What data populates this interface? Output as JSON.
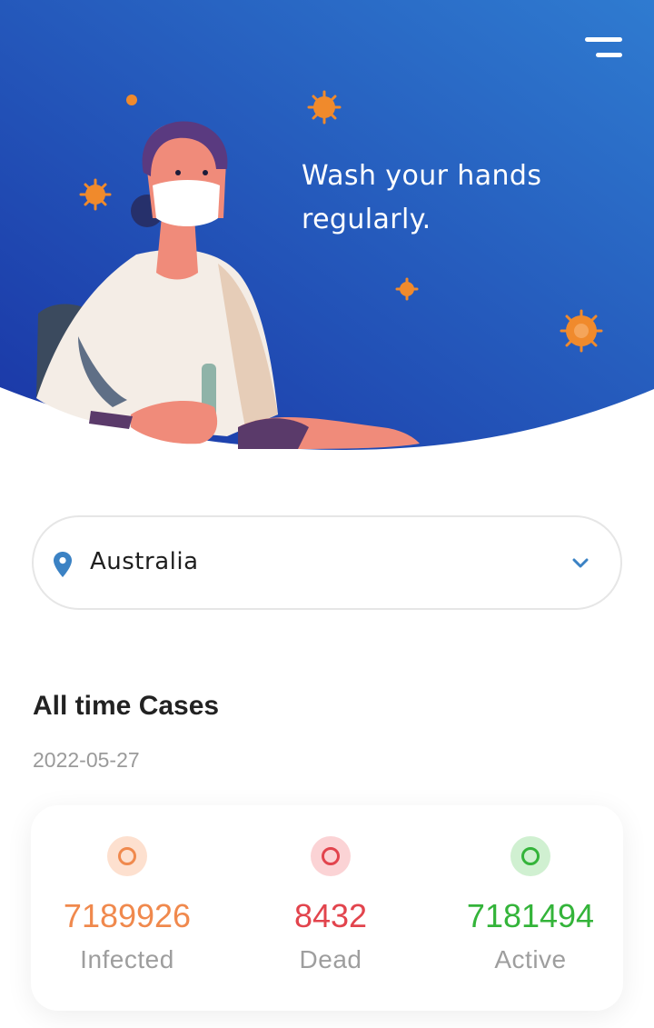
{
  "hero": {
    "message": "Wash your hands regularly.",
    "gradient": [
      "#1a36a6",
      "#2f7bd0"
    ]
  },
  "header": {
    "menu_icon": "menu-icon"
  },
  "country_select": {
    "icon": "location-pin-icon",
    "value": "Australia",
    "dropdown_icon": "chevron-down-icon",
    "accent": "#3b82c4"
  },
  "cases": {
    "title": "All time Cases",
    "date": "2022-05-27",
    "stats": [
      {
        "key": "infected",
        "value": "7189926",
        "label": "Infected",
        "color": "#f0894d",
        "bg": "#fde0cf"
      },
      {
        "key": "dead",
        "value": "8432",
        "label": "Dead",
        "color": "#e2444d",
        "bg": "#fbd3d5"
      },
      {
        "key": "active",
        "value": "7181494",
        "label": "Active",
        "color": "#34b43a",
        "bg": "#d0f0d1"
      }
    ]
  }
}
